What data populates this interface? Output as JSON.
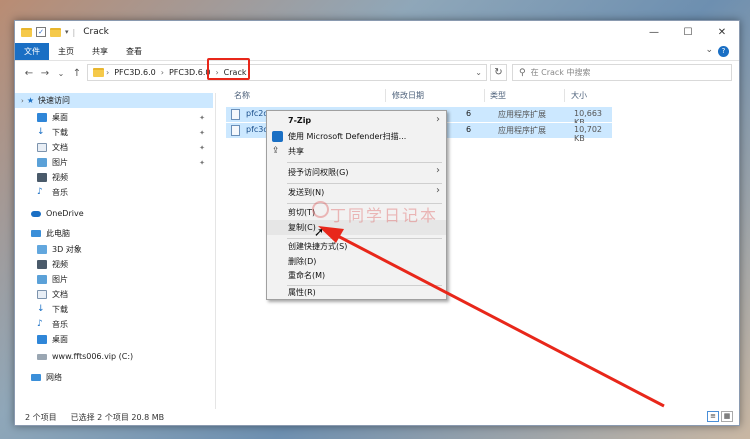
{
  "window": {
    "title": "Crack",
    "controls": {
      "minimize": "—",
      "maximize": "☐",
      "close": "✕"
    }
  },
  "ribbon": {
    "tabs": [
      "文件",
      "主页",
      "共享",
      "查看"
    ],
    "help": "?"
  },
  "nav": {
    "back": "←",
    "forward": "→",
    "dropdown": "⌄",
    "up": "↑",
    "breadcrumb": [
      "PFC3D.6.0",
      "PFC3D.6.0",
      "Crack"
    ],
    "refresh": "↻",
    "search_placeholder": "在 Crack 中搜索"
  },
  "sidebar": {
    "quick_access": "快速访问",
    "quick_items": [
      "桌面",
      "下载",
      "文档",
      "图片",
      "视频",
      "音乐"
    ],
    "onedrive": "OneDrive",
    "this_pc": "此电脑",
    "pc_items": [
      "3D 对象",
      "视频",
      "图片",
      "文档",
      "下载",
      "音乐",
      "桌面",
      "www.ffts006.vip (C:)"
    ],
    "network": "网络"
  },
  "columns": [
    "名称",
    "修改日期",
    "类型",
    "大小"
  ],
  "files": [
    {
      "name": "pfc2d6",
      "date": "6",
      "type": "应用程序扩展",
      "size": "10,663 KB"
    },
    {
      "name": "pfc3d6",
      "date": "6",
      "type": "应用程序扩展",
      "size": "10,702 KB"
    }
  ],
  "status": {
    "count": "2 个项目",
    "selected": "已选择 2 个项目 20.8 MB"
  },
  "context_menu": {
    "items": [
      {
        "label": "7-Zip",
        "submenu": true,
        "icon": ""
      },
      {
        "label": "使用 Microsoft Defender扫描...",
        "submenu": false,
        "icon": "defender-icon"
      },
      {
        "label": "共享",
        "submenu": false,
        "icon": "share-icon"
      },
      {
        "label": "授予访问权限(G)",
        "submenu": true,
        "icon": ""
      },
      {
        "label": "发送到(N)",
        "submenu": true,
        "icon": ""
      },
      {
        "label": "剪切(T)",
        "submenu": false,
        "icon": ""
      },
      {
        "label": "复制(C)",
        "submenu": false,
        "icon": ""
      },
      {
        "label": "创建快捷方式(S)",
        "submenu": false,
        "icon": ""
      },
      {
        "label": "删除(D)",
        "submenu": false,
        "icon": ""
      },
      {
        "label": "重命名(M)",
        "submenu": false,
        "icon": ""
      },
      {
        "label": "属性(R)",
        "submenu": false,
        "icon": ""
      }
    ]
  },
  "watermark": "丁同学日记本",
  "colors": {
    "accent": "#1a6fc4",
    "selection": "#cce8ff",
    "annotation": "#e8271a"
  }
}
